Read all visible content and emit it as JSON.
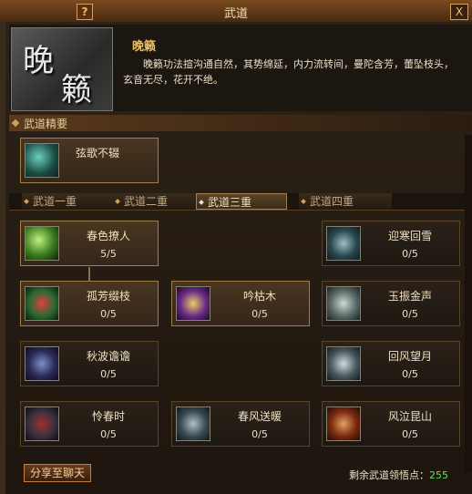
{
  "window": {
    "title": "武道",
    "help_label": "?",
    "close_label": "X"
  },
  "header": {
    "logo_char_1": "晚",
    "logo_char_2": "籁",
    "skill_name": "晚籁",
    "description": "晚籁功法揎沟通自然，其势绵延，内力流转间，曼陀含芳，蕾坠枝头，玄音无尽，花开不绝。"
  },
  "section": {
    "title": "武道精要"
  },
  "essence": {
    "name": "弦歌不辍",
    "icon": "jade-swirl-icon"
  },
  "tabs": [
    {
      "label": "武道一重"
    },
    {
      "label": "武道二重"
    },
    {
      "label": "武道三重",
      "selected": true
    },
    {
      "label": "武道四重"
    }
  ],
  "skills": [
    {
      "name": "春色撩人",
      "progress": "5/5",
      "icon": "green-crescent-icon"
    },
    {
      "name": "迎寒回雪",
      "progress": "0/5",
      "icon": "blue-swirl-icon"
    },
    {
      "name": "孤芳缀枝",
      "progress": "0/5",
      "icon": "red-flower-icon"
    },
    {
      "name": "吟枯木",
      "progress": "0/5",
      "icon": "purple-spark-icon"
    },
    {
      "name": "玉振金声",
      "progress": "0/5",
      "icon": "white-burst-icon"
    },
    {
      "name": "秋波谵谵",
      "progress": "0/5",
      "icon": "blue-wave-icon"
    },
    {
      "name": "回风望月",
      "progress": "0/5",
      "icon": "moon-wind-icon"
    },
    {
      "name": "怜春时",
      "progress": "0/5",
      "icon": "red-blossom-icon"
    },
    {
      "name": "春风送暖",
      "progress": "0/5",
      "icon": "wind-stroke-icon"
    },
    {
      "name": "风泣昆山",
      "progress": "0/5",
      "icon": "fire-vortex-icon"
    }
  ],
  "footer": {
    "share_label": "分享至聊天",
    "points_label": "剩余武道领悟点：",
    "points_value": "255"
  }
}
